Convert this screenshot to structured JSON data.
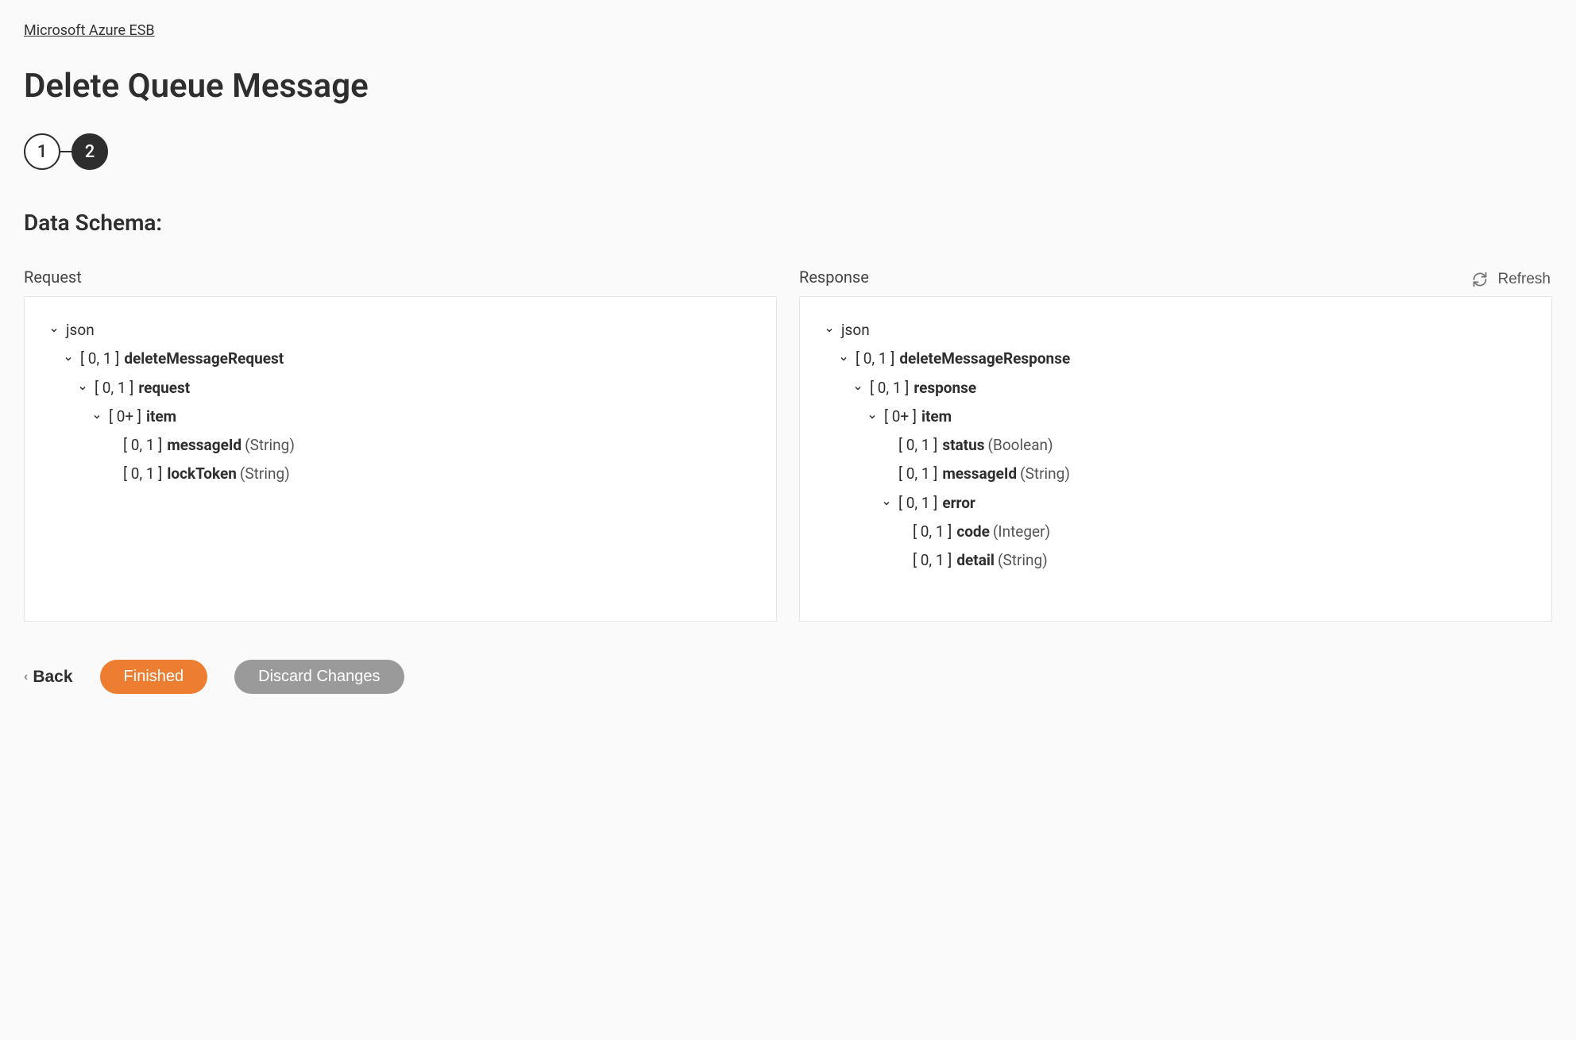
{
  "breadcrumb": "Microsoft Azure ESB",
  "pageTitle": "Delete Queue Message",
  "stepper": {
    "step1": "1",
    "step2": "2"
  },
  "sectionHeading": "Data Schema:",
  "refreshLabel": "Refresh",
  "panels": {
    "request": {
      "label": "Request",
      "root": "json",
      "tree": {
        "l1_card": "[ 0, 1 ]",
        "l1_name": "deleteMessageRequest",
        "l2_card": "[ 0, 1 ]",
        "l2_name": "request",
        "l3_card": "[ 0+ ]",
        "l3_name": "item",
        "l4a_card": "[ 0, 1 ]",
        "l4a_name": "messageId",
        "l4a_type": "(String)",
        "l4b_card": "[ 0, 1 ]",
        "l4b_name": "lockToken",
        "l4b_type": "(String)"
      }
    },
    "response": {
      "label": "Response",
      "root": "json",
      "tree": {
        "l1_card": "[ 0, 1 ]",
        "l1_name": "deleteMessageResponse",
        "l2_card": "[ 0, 1 ]",
        "l2_name": "response",
        "l3_card": "[ 0+ ]",
        "l3_name": "item",
        "l4a_card": "[ 0, 1 ]",
        "l4a_name": "status",
        "l4a_type": "(Boolean)",
        "l4b_card": "[ 0, 1 ]",
        "l4b_name": "messageId",
        "l4b_type": "(String)",
        "l4c_card": "[ 0, 1 ]",
        "l4c_name": "error",
        "l5a_card": "[ 0, 1 ]",
        "l5a_name": "code",
        "l5a_type": "(Integer)",
        "l5b_card": "[ 0, 1 ]",
        "l5b_name": "detail",
        "l5b_type": "(String)"
      }
    }
  },
  "footer": {
    "backLabel": "Back",
    "finishedLabel": "Finished",
    "discardLabel": "Discard Changes"
  }
}
